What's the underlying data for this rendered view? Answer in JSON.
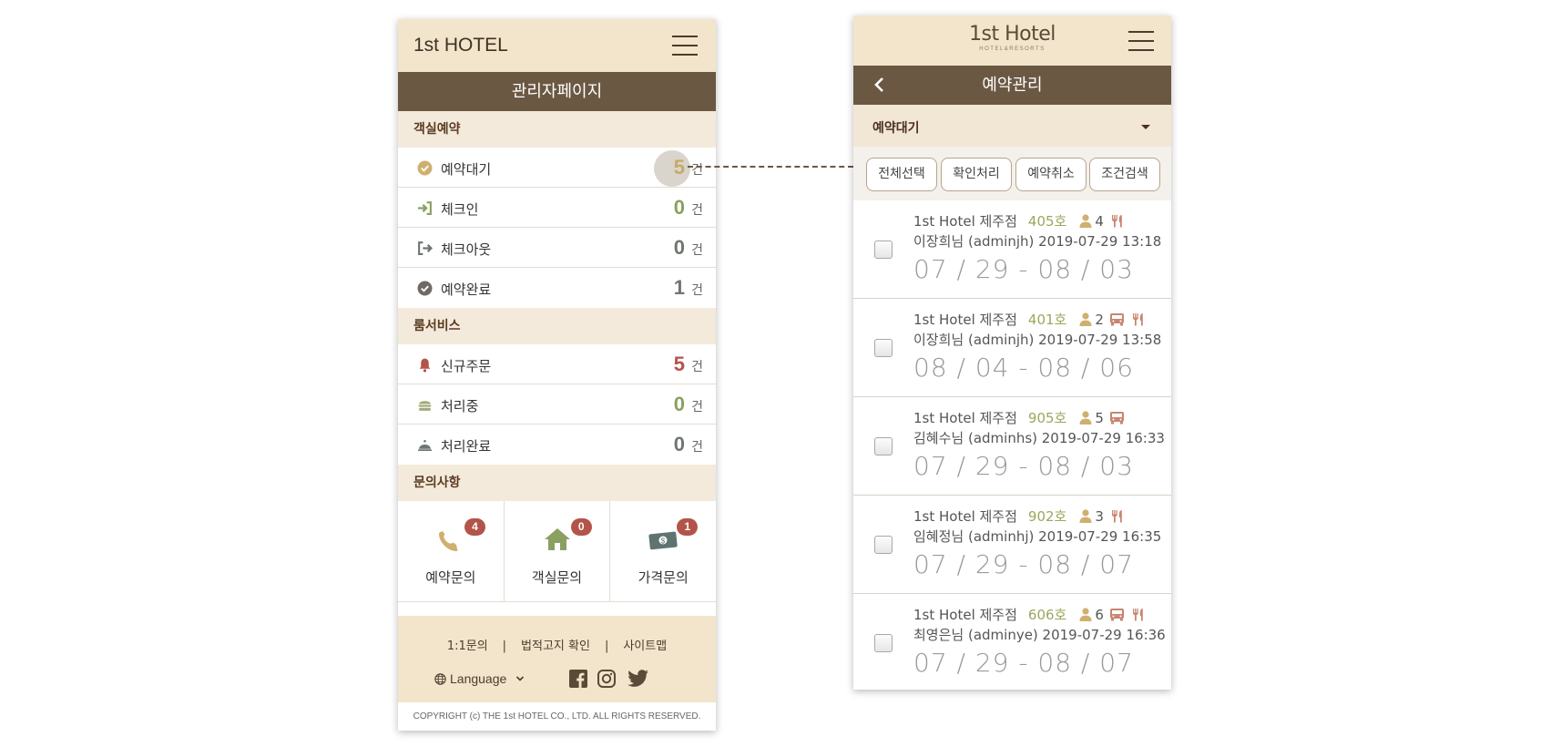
{
  "admin": {
    "brand": "1st HOTEL",
    "page_title": "관리자페이지",
    "sections": [
      {
        "title": "객실예약",
        "rows": [
          {
            "label": "예약대기",
            "count": "5",
            "unit": "건",
            "icon": "check-circle-icon"
          },
          {
            "label": "체크인",
            "count": "0",
            "unit": "건",
            "icon": "sign-in-icon"
          },
          {
            "label": "체크아웃",
            "count": "0",
            "unit": "건",
            "icon": "sign-out-icon"
          },
          {
            "label": "예약완료",
            "count": "1",
            "unit": "건",
            "icon": "check-circle-icon"
          }
        ]
      },
      {
        "title": "룸서비스",
        "rows": [
          {
            "label": "신규주문",
            "count": "5",
            "unit": "건",
            "icon": "bell-icon"
          },
          {
            "label": "처리중",
            "count": "0",
            "unit": "건",
            "icon": "burger-icon"
          },
          {
            "label": "처리완료",
            "count": "0",
            "unit": "건",
            "icon": "cloche-icon"
          }
        ]
      },
      {
        "title": "문의사항",
        "inquiries": [
          {
            "label": "예약문의",
            "badge": "4",
            "icon": "phone-icon"
          },
          {
            "label": "객실문의",
            "badge": "0",
            "icon": "home-icon"
          },
          {
            "label": "가격문의",
            "badge": "1",
            "icon": "money-icon"
          }
        ]
      }
    ],
    "footer": {
      "links": [
        "1:1문의",
        "법적고지 확인",
        "사이트맵"
      ],
      "language": "Language",
      "copyright": "COPYRIGHT (c) THE 1st HOTEL CO., LTD. ALL RIGHTS RESERVED."
    }
  },
  "reservations": {
    "logo_main": "1st Hotel",
    "logo_sub": "HOTEL&RESORTS",
    "title": "예약관리",
    "filter": "예약대기",
    "buttons": [
      "전체선택",
      "확인처리",
      "예약취소",
      "조건검색"
    ],
    "items": [
      {
        "hotel": "1st Hotel 제주점",
        "room": "405호",
        "guests": "4",
        "bus": false,
        "dining": true,
        "guest_line": "이장희님 (adminjh) 2019-07-29 13:18",
        "dates": "07 / 29 - 08 / 03"
      },
      {
        "hotel": "1st Hotel 제주점",
        "room": "401호",
        "guests": "2",
        "bus": true,
        "dining": true,
        "guest_line": "이장희님 (adminjh) 2019-07-29 13:58",
        "dates": "08 / 04 - 08 / 06"
      },
      {
        "hotel": "1st Hotel 제주점",
        "room": "905호",
        "guests": "5",
        "bus": true,
        "dining": false,
        "guest_line": "김혜수님 (adminhs) 2019-07-29 16:33",
        "dates": "07 / 29 - 08 / 03"
      },
      {
        "hotel": "1st Hotel 제주점",
        "room": "902호",
        "guests": "3",
        "bus": false,
        "dining": true,
        "guest_line": "임혜정님 (adminhj) 2019-07-29 16:35",
        "dates": "07 / 29 - 08 / 07"
      },
      {
        "hotel": "1st Hotel 제주점",
        "room": "606호",
        "guests": "6",
        "bus": true,
        "dining": true,
        "guest_line": "최영은님 (adminye) 2019-07-29 16:36",
        "dates": "07 / 29 - 08 / 07"
      }
    ]
  },
  "colors": {
    "header_bg": "#f2e5cb",
    "title_bar": "#6b5843",
    "count_gold": "#c8a96a",
    "count_green": "#8aa060",
    "count_gray": "#6e7670",
    "count_red": "#b3544a",
    "badge_red": "#b3544a"
  }
}
